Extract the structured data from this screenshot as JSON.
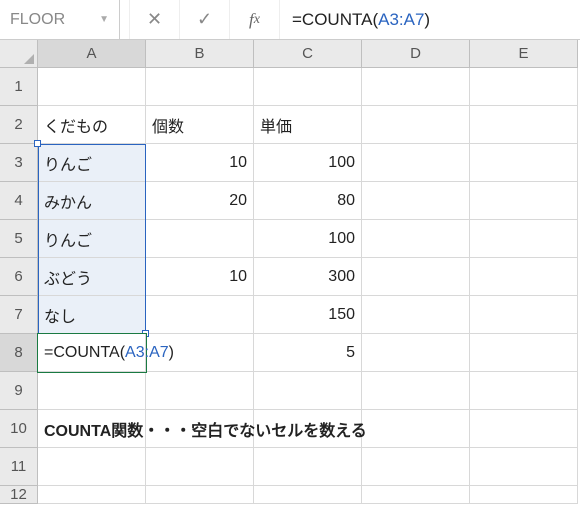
{
  "name_box": "FLOOR",
  "formula_bar": {
    "prefix": "=COUNTA(",
    "ref": "A3:A7",
    "suffix": ")"
  },
  "columns": [
    "A",
    "B",
    "C",
    "D",
    "E"
  ],
  "rows": [
    "1",
    "2",
    "3",
    "4",
    "5",
    "6",
    "7",
    "8",
    "9",
    "10",
    "11",
    "12"
  ],
  "cells": {
    "A2": "くだもの",
    "B2": "個数",
    "C2": "単価",
    "A3": "りんご",
    "B3": "10",
    "C3": "100",
    "A4": "みかん",
    "B4": "20",
    "C4": "80",
    "A5": "りんご",
    "C5": "100",
    "A6": "ぶどう",
    "B6": "10",
    "C6": "300",
    "A7": "なし",
    "C7": "150",
    "C8": "5"
  },
  "editing": {
    "prefix": "=COUNTA(",
    "ref": "A3:A7",
    "suffix": ")"
  },
  "note": "COUNTA関数・・・空白でないセルを数える"
}
